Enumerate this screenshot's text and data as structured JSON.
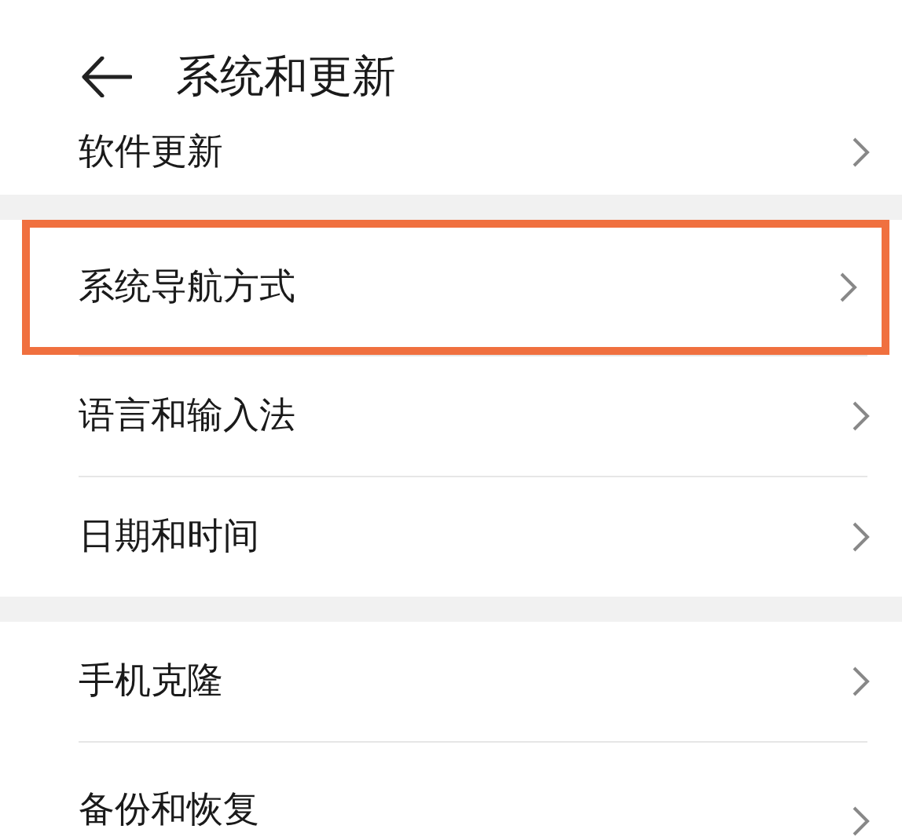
{
  "header": {
    "title": "系统和更新"
  },
  "sections": [
    {
      "items": [
        {
          "label": "软件更新",
          "highlighted": false
        }
      ]
    },
    {
      "items": [
        {
          "label": "系统导航方式",
          "highlighted": true
        },
        {
          "label": "语言和输入法",
          "highlighted": false
        },
        {
          "label": "日期和时间",
          "highlighted": false
        }
      ]
    },
    {
      "items": [
        {
          "label": "手机克隆",
          "highlighted": false
        },
        {
          "label": "备份和恢复",
          "highlighted": false
        }
      ]
    }
  ]
}
